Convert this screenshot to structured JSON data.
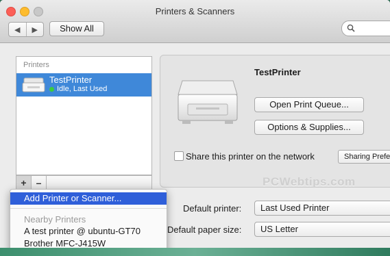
{
  "window": {
    "title": "Printers & Scanners",
    "nav": {
      "back": "◀",
      "forward": "▶"
    },
    "show_all": "Show All",
    "search": {
      "placeholder": ""
    }
  },
  "printers_list": {
    "header": "Printers",
    "items": [
      {
        "name": "TestPrinter",
        "status": "Idle, Last Used",
        "status_color": "#3ccd3c",
        "selected": true
      }
    ],
    "add_button": "+",
    "remove_button": "–"
  },
  "detail": {
    "printer_name": "TestPrinter",
    "open_queue_button": "Open Print Queue...",
    "options_button": "Options & Supplies...",
    "share_label": "Share this printer on the network",
    "share_checked": false,
    "sharing_prefs_button": "Sharing Prefe"
  },
  "watermark": "PCWebtips.com",
  "defaults": {
    "default_printer_label": "Default printer:",
    "default_printer_value": "Last Used Printer",
    "paper_size_label": "Default paper size:",
    "paper_size_value": "US Letter"
  },
  "add_menu": {
    "selected_item": "Add Printer or Scanner...",
    "nearby_header": "Nearby Printers",
    "nearby_items": [
      "A test printer @ ubuntu-GT70",
      "Brother MFC-J415W"
    ]
  },
  "colors": {
    "selection": "#3f88d9",
    "menu_highlight": "#2f5fd9"
  }
}
